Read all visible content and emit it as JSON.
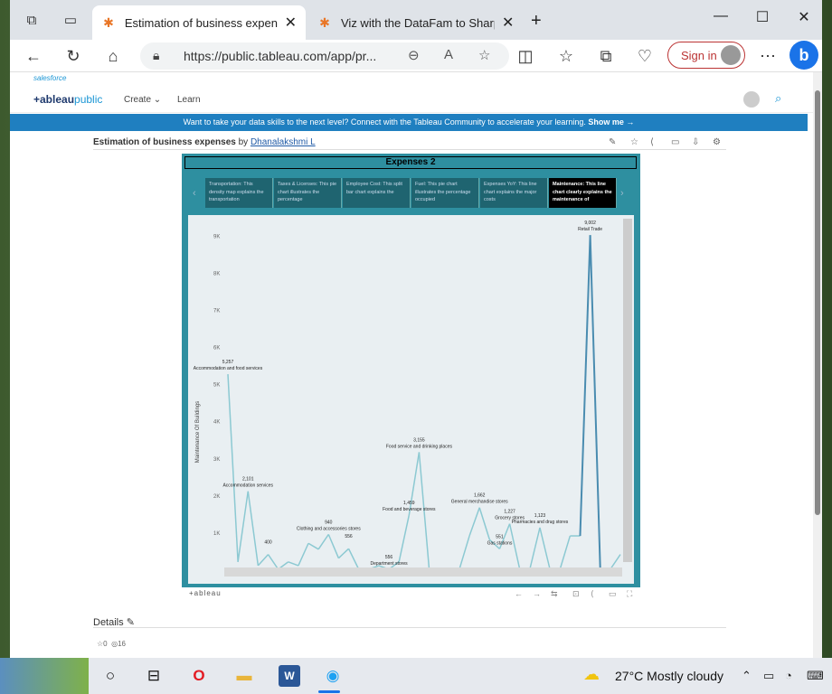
{
  "browser": {
    "tabs": [
      {
        "title": "Estimation of business expenses",
        "active": true
      },
      {
        "title": "Viz with the DataFam to Sharpen",
        "active": false
      }
    ],
    "url": "https://public.tableau.com/app/pr...",
    "sign_in": "Sign in"
  },
  "page": {
    "salesforce": "salesforce",
    "logo_main": "+ableau",
    "logo_sub": "public",
    "nav": {
      "create": "Create",
      "learn": "Learn"
    },
    "banner_text": "Want to take your data skills to the next level? Connect with the Tableau Community to accelerate your learning.",
    "banner_link": "Show me →",
    "viz_title": "Estimation of business expenses",
    "by": "by",
    "author": "Dhanalakshmi L",
    "details": "Details",
    "favorites": "0",
    "views": "16"
  },
  "viz": {
    "header": "Expenses 2",
    "story_points": [
      {
        "text": "Transportation: This density map explains the transportation",
        "active": false
      },
      {
        "text": "Taxes & Licenses: This pie chart illustrates the percentage",
        "active": false
      },
      {
        "text": "Employee Cost: This split bar chart explains the",
        "active": false
      },
      {
        "text": "Fuel: This pie chart illustrates the percentage occupied",
        "active": false
      },
      {
        "text": "Expenses YoY: This line chart explains the major costs",
        "active": false
      },
      {
        "text": "Maintenance: This line chart clearly explains the maintenance of",
        "active": true
      }
    ],
    "footer_logo": "+ableau"
  },
  "chart_data": {
    "type": "line",
    "ylabel": "Maintenance Of Buildings",
    "yticks": [
      "1K",
      "2K",
      "3K",
      "4K",
      "5K",
      "6K",
      "7K",
      "8K",
      "9K"
    ],
    "ylim": [
      0,
      9300
    ],
    "series": [
      {
        "values": [
          5257,
          200,
          2101,
          100,
          400,
          0,
          200,
          100,
          700,
          540,
          940,
          300,
          556,
          0,
          0,
          100,
          0,
          200,
          1459,
          3155,
          0,
          0,
          0,
          0,
          900,
          1662,
          800,
          551,
          1227,
          0,
          0,
          1123,
          0,
          0,
          900,
          900,
          9002,
          0,
          0,
          400
        ]
      }
    ],
    "annotations": [
      {
        "value": "5,257",
        "label": "Accommodation and food services",
        "index": 0
      },
      {
        "value": "2,101",
        "label": "Accommodation services",
        "index": 2
      },
      {
        "value": "400",
        "label": "",
        "index": 4
      },
      {
        "value": "940",
        "label": "Clothing and accessories stores",
        "index": 10
      },
      {
        "value": "556",
        "label": "",
        "index": 12
      },
      {
        "value": "556",
        "label": "Department stores",
        "index": 16
      },
      {
        "value": "1,459",
        "label": "Food and beverage stores",
        "index": 18
      },
      {
        "value": "3,155",
        "label": "Food service and drinking places",
        "index": 19
      },
      {
        "value": "1,662",
        "label": "General merchandise stores",
        "index": 25
      },
      {
        "value": "1,227",
        "label": "Grocery stores",
        "index": 28
      },
      {
        "value": "551",
        "label": "Gas stations",
        "index": 27
      },
      {
        "value": "1,123",
        "label": "Pharmacies and drug stores",
        "index": 31
      },
      {
        "value": "9,002",
        "label": "Retail Trade",
        "index": 36
      }
    ],
    "line_color": "#8cc9d2",
    "highlight_color": "#4a8cb0"
  },
  "taskbar": {
    "weather": "27°C  Mostly cloudy"
  }
}
